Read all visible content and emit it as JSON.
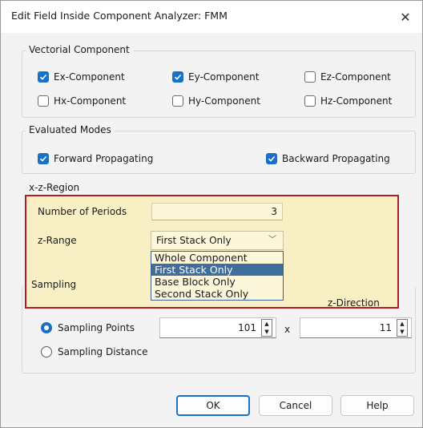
{
  "window": {
    "title": "Edit Field Inside Component Analyzer: FMM",
    "close_glyph": "✕"
  },
  "vectorial": {
    "label": "Vectorial Component",
    "items": [
      {
        "label": "Ex-Component",
        "checked": true
      },
      {
        "label": "Ey-Component",
        "checked": true
      },
      {
        "label": "Ez-Component",
        "checked": false
      },
      {
        "label": "Hx-Component",
        "checked": false
      },
      {
        "label": "Hy-Component",
        "checked": false
      },
      {
        "label": "Hz-Component",
        "checked": false
      }
    ]
  },
  "modes": {
    "label": "Evaluated Modes",
    "forward": {
      "label": "Forward Propagating",
      "checked": true
    },
    "backward": {
      "label": "Backward Propagating",
      "checked": true
    }
  },
  "region": {
    "label": "x-z-Region",
    "periods_label": "Number of Periods",
    "periods_value": "3",
    "zrange_label": "z-Range",
    "zrange_value": "First Stack Only",
    "options": [
      "Whole Component",
      "First Stack Only",
      "Base Block Only",
      "Second Stack Only"
    ],
    "selected_index": 1
  },
  "sampling": {
    "label": "Sampling",
    "zdir_label": "z-Direction",
    "points": {
      "label": "Sampling Points",
      "selected": true
    },
    "distance": {
      "label": "Sampling Distance",
      "selected": false
    },
    "x_value": "101",
    "times": "x",
    "z_value": "11"
  },
  "buttons": {
    "ok": "OK",
    "cancel": "Cancel",
    "help": "Help"
  },
  "colors": {
    "accent": "#1a6fc6",
    "highlight_border": "#b01e23",
    "highlight_fill": "#f8efc4"
  }
}
